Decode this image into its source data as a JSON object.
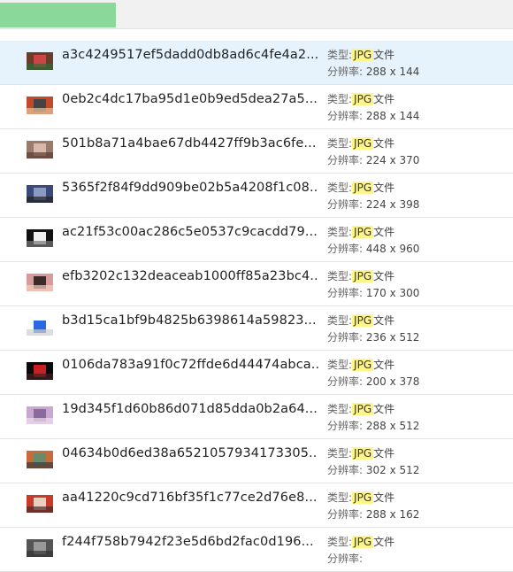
{
  "progress": {
    "fraction": 0.225,
    "color": "#8bd99a"
  },
  "labels": {
    "type_prefix": "类型:",
    "type_suffix": "文件",
    "resolution_prefix": "分辨率:"
  },
  "files": [
    {
      "name": "a3c4249517ef5dadd0db8ad6c4fe4a2...",
      "type": "JPG",
      "resolution": "288 x 144",
      "selected": true,
      "thumb_colors": [
        "#6b3b2a",
        "#c44",
        "#2e6b3a"
      ]
    },
    {
      "name": "0eb2c4dc17ba95d1e0b9ed5dea27a5...",
      "type": "JPG",
      "resolution": "288 x 144",
      "selected": false,
      "thumb_colors": [
        "#c24a2a",
        "#444",
        "#e8c4a0"
      ]
    },
    {
      "name": "501b8a71a4bae67db4427ff9b3ac6fe...",
      "type": "JPG",
      "resolution": "224 x 370",
      "selected": false,
      "thumb_colors": [
        "#9a7a6a",
        "#d8b8a8",
        "#5a3a30"
      ]
    },
    {
      "name": "5365f2f84f9dd909be02b5a4208f1c08...",
      "type": "JPG",
      "resolution": "224 x 398",
      "selected": false,
      "thumb_colors": [
        "#3a4a7a",
        "#8a9ac0",
        "#222"
      ]
    },
    {
      "name": "ac21f53c00ac286c5e0537c9cacdd79...",
      "type": "JPG",
      "resolution": "448 x 960",
      "selected": false,
      "thumb_colors": [
        "#111",
        "#eee",
        "#777"
      ]
    },
    {
      "name": "efb3202c132deaceab1000ff85a23bc4...",
      "type": "JPG",
      "resolution": "170 x 300",
      "selected": false,
      "thumb_colors": [
        "#d89a9a",
        "#3a2a2a",
        "#f4d0c0"
      ]
    },
    {
      "name": "b3d15ca1bf9b4825b6398614a59823...",
      "type": "JPG",
      "resolution": "236 x 512",
      "selected": false,
      "thumb_colors": [
        "#ffffff",
        "#2a6ae0",
        "#cfcfcf"
      ]
    },
    {
      "name": "0106da783a91f0c72ffde6d44474abca...",
      "type": "JPG",
      "resolution": "200 x 378",
      "selected": false,
      "thumb_colors": [
        "#0a0a0a",
        "#c82020",
        "#402020"
      ]
    },
    {
      "name": "19d345f1d60b86d071d85dda0b2a64...",
      "type": "JPG",
      "resolution": "288 x 512",
      "selected": false,
      "thumb_colors": [
        "#c8a8d0",
        "#8a6a9a",
        "#efe0f0"
      ]
    },
    {
      "name": "04634b0d6ed38a6521057934173305...",
      "type": "JPG",
      "resolution": "302 x 512",
      "selected": false,
      "thumb_colors": [
        "#c86a3a",
        "#6a8a6a",
        "#3a3a3a"
      ]
    },
    {
      "name": "aa41220c9cd716bf35f1c77ce2d76e8...",
      "type": "JPG",
      "resolution": "288 x 162",
      "selected": false,
      "thumb_colors": [
        "#c83a2a",
        "#e8d0c0",
        "#4a2a2a"
      ]
    },
    {
      "name": "f244f758b7942f23e5d6bd2fac0d196...",
      "type": "JPG",
      "resolution": "",
      "selected": false,
      "thumb_colors": [
        "#555",
        "#999",
        "#333"
      ]
    }
  ]
}
